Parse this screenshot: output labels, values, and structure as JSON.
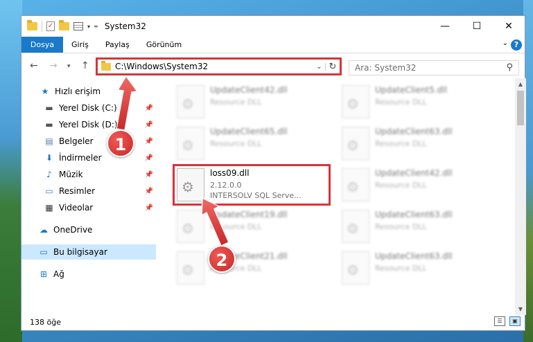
{
  "window": {
    "title": "System32",
    "controls": {
      "minimize": "—",
      "maximize": "☐",
      "close": "✕"
    }
  },
  "ribbon": {
    "tabs": [
      "Dosya",
      "Giriş",
      "Paylaş",
      "Görünüm"
    ],
    "help": "?"
  },
  "address": {
    "path": "C:\\Windows\\System32",
    "search_placeholder": "Ara: System32"
  },
  "nav": {
    "quick_access": "Hızlı erişim",
    "items": [
      {
        "label": "Yerel Disk (C:)",
        "icon": "drive-icon",
        "pinned": true
      },
      {
        "label": "Yerel Disk (D:)",
        "icon": "drive-icon",
        "pinned": true
      },
      {
        "label": "Belgeler",
        "icon": "documents-icon",
        "pinned": true
      },
      {
        "label": "İndirmeler",
        "icon": "download-icon",
        "pinned": true
      },
      {
        "label": "Müzik",
        "icon": "music-icon",
        "pinned": true
      },
      {
        "label": "Resimler",
        "icon": "pictures-icon",
        "pinned": true
      },
      {
        "label": "Videolar",
        "icon": "videos-icon",
        "pinned": true
      }
    ],
    "onedrive": "OneDrive",
    "this_pc": "Bu bilgisayar",
    "network": "Ağ"
  },
  "files": {
    "left_column": [
      {
        "name": "UpdateClient42.dll",
        "sub": "Resource DLL"
      },
      {
        "name": "UpdateClient65.dll",
        "sub": "Resource DLL"
      },
      {
        "name": "loss09.dll",
        "sub1": "2.12.0.0",
        "sub2": "INTERSOLV SQL Serve..."
      },
      {
        "name": "UpdateClient19.dll",
        "sub": "Resource DLL"
      },
      {
        "name": "UpdateClient21.dll",
        "sub": "Resource DLL"
      }
    ],
    "right_column": [
      {
        "name": "UpdateClient5.dll",
        "sub": "Resource DLL"
      },
      {
        "name": "UpdateClient63.dll",
        "sub": "Resource DLL"
      },
      {
        "name": "UpdateClient42.dll",
        "sub": "Resource DLL"
      },
      {
        "name": "UpdateClient63.dll",
        "sub": "Resource DLL"
      },
      {
        "name": "UpdateClient63.dll",
        "sub": "Resource DLL"
      }
    ]
  },
  "status": {
    "count": "138 öğe"
  },
  "badges": {
    "one": "1",
    "two": "2"
  },
  "colors": {
    "accent": "#1979ca",
    "highlight": "#d9323a",
    "selection": "#cce8ff"
  }
}
